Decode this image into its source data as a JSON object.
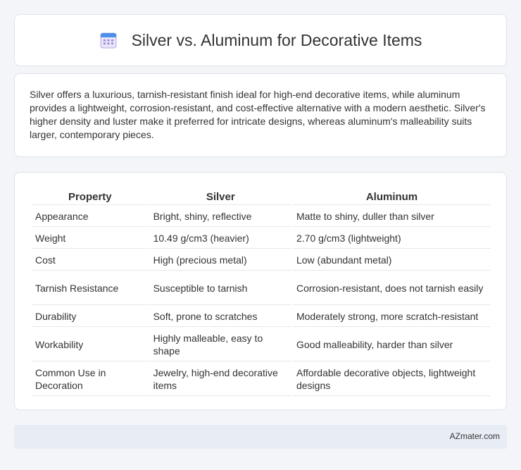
{
  "header": {
    "title": "Silver vs. Aluminum for Decorative Items",
    "icon": "calendar-icon"
  },
  "summary": {
    "text": "Silver offers a luxurious, tarnish-resistant finish ideal for high-end decorative items, while aluminum provides a lightweight, corrosion-resistant, and cost-effective alternative with a modern aesthetic. Silver's higher density and luster make it preferred for intricate designs, whereas aluminum's malleability suits larger, contemporary pieces."
  },
  "table": {
    "headers": [
      "Property",
      "Silver",
      "Aluminum"
    ],
    "rows": [
      [
        "Appearance",
        "Bright, shiny, reflective",
        "Matte to shiny, duller than silver"
      ],
      [
        "Weight",
        "10.49 g/cm3 (heavier)",
        "2.70 g/cm3 (lightweight)"
      ],
      [
        "Cost",
        "High (precious metal)",
        "Low (abundant metal)"
      ],
      [
        "Tarnish Resistance",
        "Susceptible to tarnish",
        "Corrosion-resistant, does not tarnish easily"
      ],
      [
        "Durability",
        "Soft, prone to scratches",
        "Moderately strong, more scratch-resistant"
      ],
      [
        "Workability",
        "Highly malleable, easy to shape",
        "Good malleability, harder than silver"
      ],
      [
        "Common Use in Decoration",
        "Jewelry, high-end decorative items",
        "Affordable decorative objects, lightweight designs"
      ]
    ]
  },
  "footer": {
    "text": "AZmater.com"
  }
}
